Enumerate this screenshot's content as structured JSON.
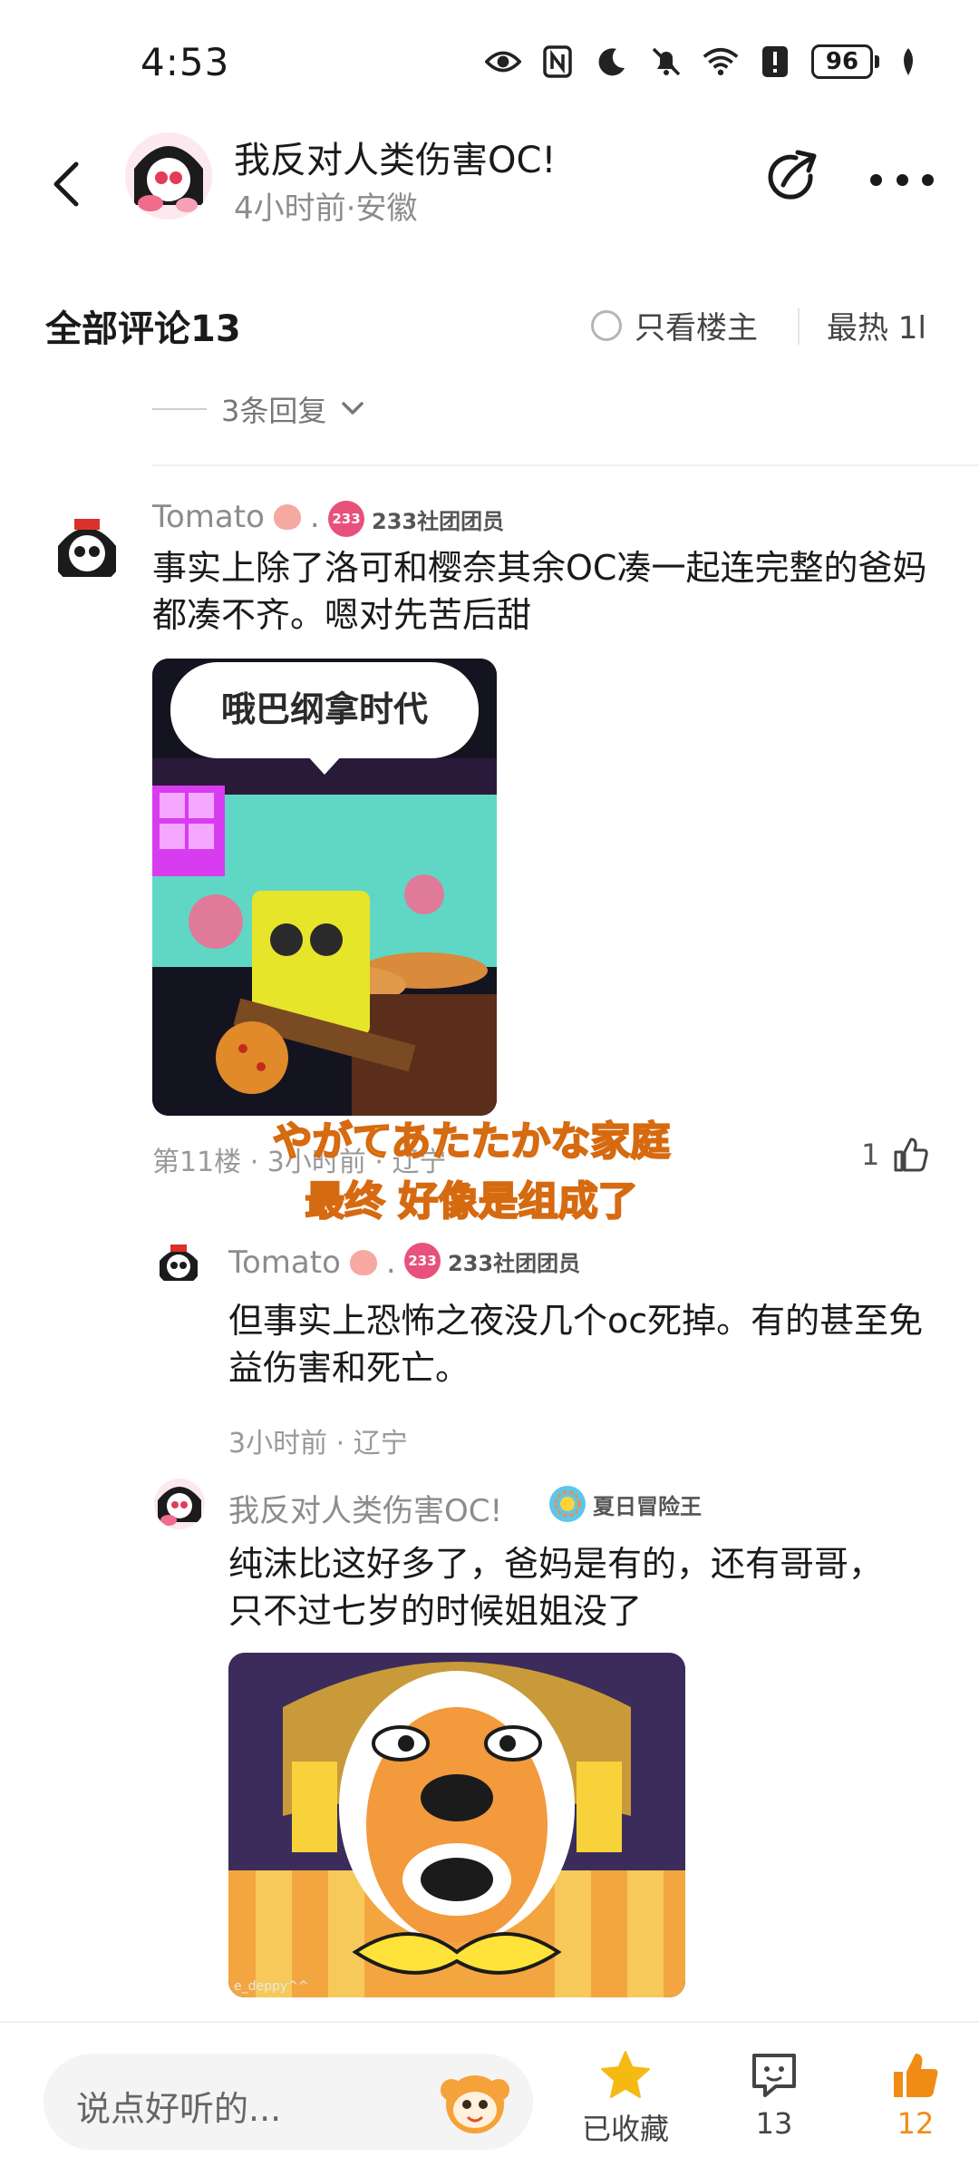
{
  "status_bar": {
    "time": "4:53",
    "battery": "96",
    "icons": [
      "eye-icon",
      "nfc-icon",
      "moon-icon",
      "bell-off-icon",
      "wifi-icon",
      "alert-icon",
      "battery-icon",
      "leaf-icon"
    ]
  },
  "header": {
    "title": "我反对人类伤害OC!",
    "meta": "4小时前·安徽",
    "back_icon": "chevron-left-icon",
    "share_icon": "share-icon",
    "more_icon": "more-icon"
  },
  "comments_header": {
    "title": "全部评论13",
    "only_op_label": "只看楼主",
    "sort_label": "最热 1l"
  },
  "replies_toggle": {
    "label": "3条回复"
  },
  "comment": {
    "username": "Tomato",
    "username_suffix": ".",
    "badge": "233社团团员",
    "badge_icon_text": "233",
    "text": "事实上除了洛可和樱奈其余OC凑一起连完整的爸妈都凑不齐。嗯对先苦后甜",
    "image_caption": "哦巴纲拿时代",
    "meta": "第11楼 · 3小时前 · 辽宁",
    "likes": "1"
  },
  "subtitles": {
    "line1": "やがてあたたかな家庭",
    "line2": "最终 好像是组成了"
  },
  "replies": [
    {
      "username": "Tomato",
      "username_suffix": ".",
      "badge": "233社团团员",
      "badge_icon_text": "233",
      "text": "但事实上恐怖之夜没几个oc死掉。有的甚至免益伤害和死亡。",
      "meta": "3小时前 · 辽宁"
    },
    {
      "username": "我反对人类伤害OC!",
      "badge": "夏日冒险王",
      "text": "纯沫比这好多了，爸妈是有的，还有哥哥，只不过七岁的时候姐姐没了",
      "image_watermark": "e_deppy^^"
    }
  ],
  "bottom_bar": {
    "input_placeholder": "说点好听的...",
    "favorite_label": "已收藏",
    "comments_count": "13",
    "likes_count": "12",
    "accent": "#f08c14"
  }
}
